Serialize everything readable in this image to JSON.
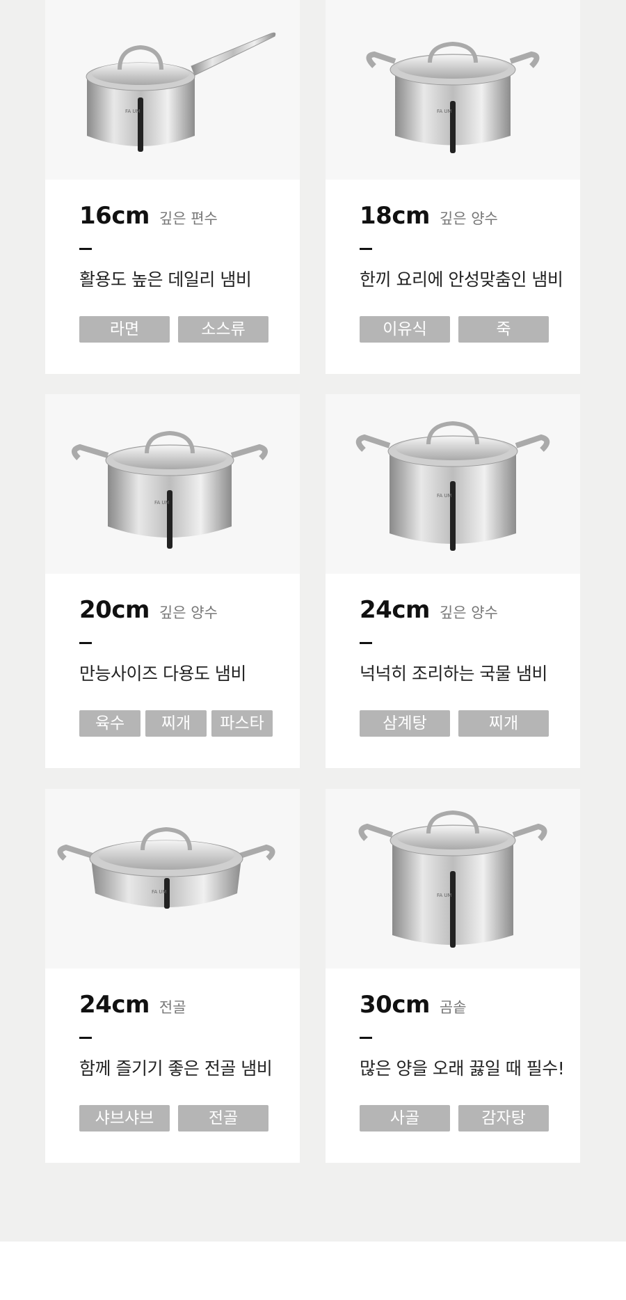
{
  "products": [
    {
      "size": "16cm",
      "kind": "깊은 편수",
      "dash": "–",
      "desc": "활용도 높은 데일리 냄비",
      "tags": [
        "라면",
        "소스류"
      ],
      "brand": "FA UM",
      "shape": "saucepan"
    },
    {
      "size": "18cm",
      "kind": "깊은 양수",
      "dash": "–",
      "desc": "한끼 요리에 안성맞춤인 냄비",
      "tags": [
        "이유식",
        "죽"
      ],
      "brand": "FA UM",
      "shape": "pot-small"
    },
    {
      "size": "20cm",
      "kind": "깊은 양수",
      "dash": "–",
      "desc": "만능사이즈 다용도 냄비",
      "tags": [
        "육수",
        "찌개",
        "파스타"
      ],
      "brand": "FA UM",
      "shape": "pot-medium"
    },
    {
      "size": "24cm",
      "kind": "깊은 양수",
      "dash": "–",
      "desc": "넉넉히 조리하는 국물 냄비",
      "tags": [
        "삼계탕",
        "찌개"
      ],
      "brand": "FA UM",
      "shape": "pot-tall"
    },
    {
      "size": "24cm",
      "kind": "전골",
      "dash": "–",
      "desc": "함께 즐기기 좋은 전골 냄비",
      "tags": [
        "샤브샤브",
        "전골"
      ],
      "brand": "FA UM",
      "shape": "casserole"
    },
    {
      "size": "30cm",
      "kind": "곰솥",
      "dash": "–",
      "desc": "많은 양을 오래 끓일 때 필수!",
      "tags": [
        "사골",
        "감자탕"
      ],
      "brand": "FA UM",
      "shape": "stockpot"
    }
  ],
  "colors": {
    "page_bg": "#f0f0ef",
    "card_bg": "#ffffff",
    "photo_bg": "#f7f7f7",
    "tag_bg": "#b5b5b5",
    "tag_text": "#ffffff"
  }
}
